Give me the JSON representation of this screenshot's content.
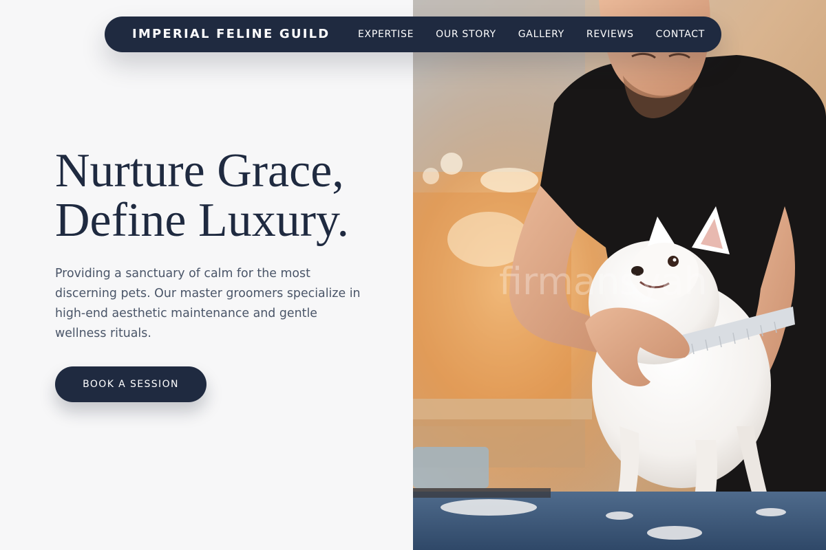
{
  "nav": {
    "brand": "IMPERIAL FELINE GUILD",
    "links": [
      "EXPERTISE",
      "OUR STORY",
      "GALLERY",
      "REVIEWS",
      "CONTACT"
    ]
  },
  "hero": {
    "headline_line1": "Nurture Grace,",
    "headline_line2": "Define Luxury.",
    "description": "Providing a sanctuary of calm for the most discerning pets. Our master groomers specialize in high-end aesthetic maintenance and gentle wellness rituals.",
    "cta_label": "BOOK A SESSION"
  },
  "photo": {
    "watermark": "firmansyah",
    "subject": "groomer combing a white Pomeranian"
  },
  "colors": {
    "primary": "#1f2a40",
    "background": "#f7f7f8",
    "body_text": "#4a5568",
    "on_primary": "#ffffff"
  }
}
